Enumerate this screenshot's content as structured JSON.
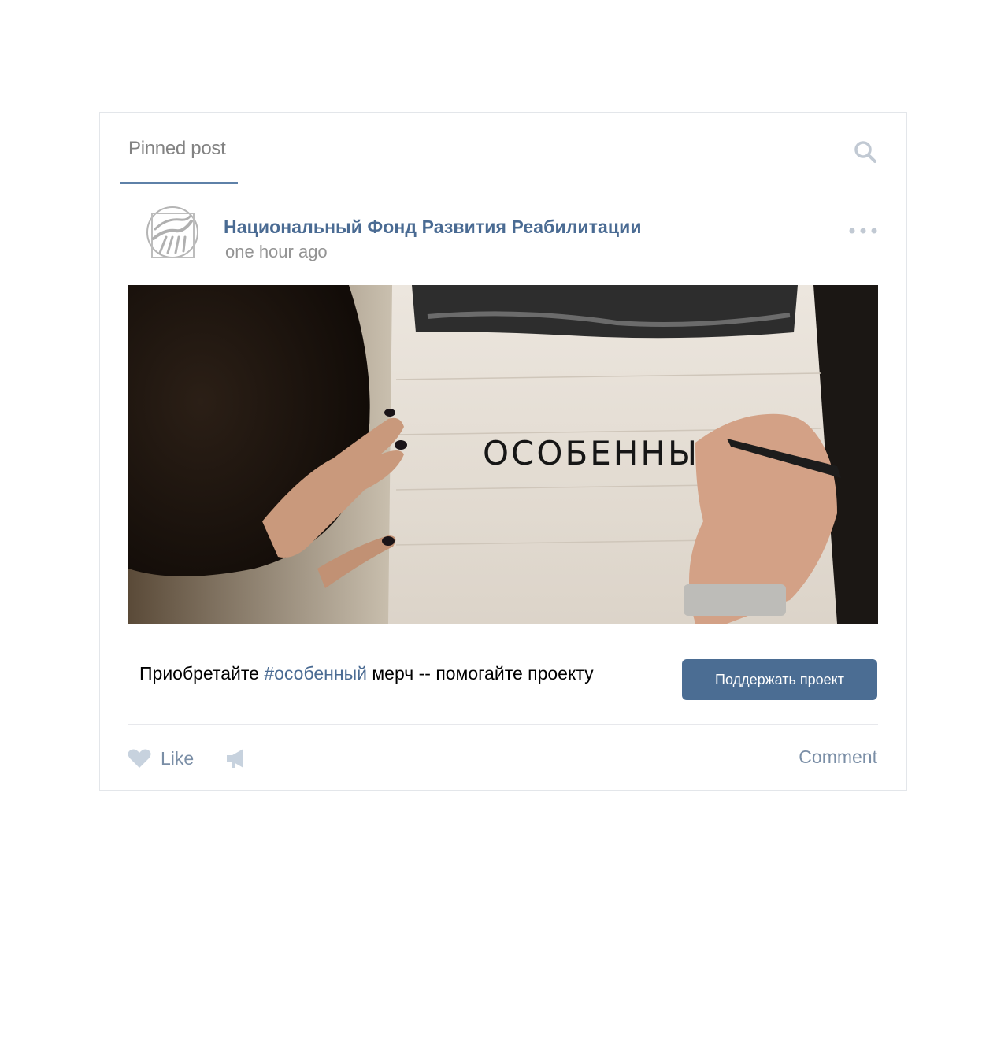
{
  "tabs": {
    "pinned_label": "Pinned post"
  },
  "post": {
    "author": "Национальный Фонд Развития Реабилитации",
    "time": "one hour ago",
    "text_before": "Приобретайте ",
    "hashtag": "#особенный",
    "text_after": " мерч -- помогайте проекту",
    "photo_text": "ОСОБЕННЫ"
  },
  "buttons": {
    "support": "Поддержать проект",
    "like": "Like",
    "comment": "Comment"
  },
  "icons": {
    "search": "search-icon",
    "more": "more-dots-icon",
    "like": "heart-icon",
    "share": "megaphone-icon"
  },
  "colors": {
    "accent": "#4b6d93",
    "link": "#4a6b93",
    "muted": "#7a8ea6"
  }
}
